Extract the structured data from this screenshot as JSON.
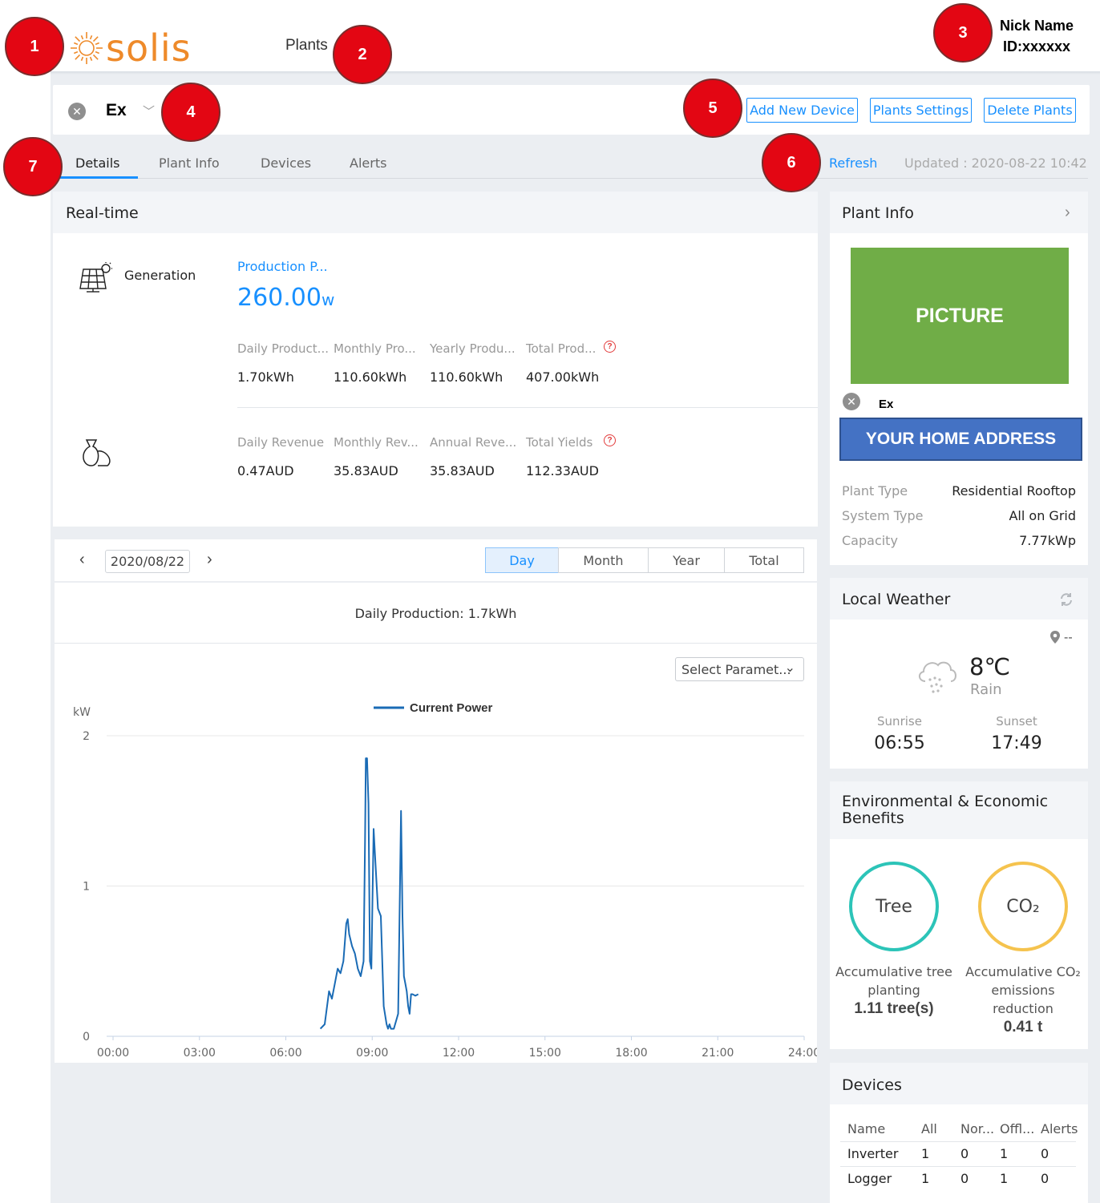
{
  "header": {
    "logo_text": "solis",
    "nav_plants": "Plants",
    "user_nick": "Nick Name",
    "user_id": "ID:xxxxxx"
  },
  "callouts": [
    "1",
    "2",
    "3",
    "4",
    "5",
    "6",
    "7"
  ],
  "plant_bar": {
    "plant_name": "Ex",
    "buttons": {
      "add_device": "Add New Device",
      "plant_settings": "Plants Settings",
      "delete_plants": "Delete Plants"
    }
  },
  "tabs": {
    "details": "Details",
    "plant_info": "Plant Info",
    "devices": "Devices",
    "alerts": "Alerts",
    "active": "Details"
  },
  "refresh": {
    "label": "Refresh",
    "updated": "Updated : 2020-08-22 10:42"
  },
  "realtime": {
    "title": "Real-time",
    "generation_label": "Generation",
    "production_label": "Production P...",
    "production_value": "260.00",
    "production_unit": "w",
    "production_stats": [
      {
        "label": "Daily Product...",
        "value": "1.70kWh"
      },
      {
        "label": "Monthly Pro...",
        "value": "110.60kWh"
      },
      {
        "label": "Yearly Produ...",
        "value": "110.60kWh"
      },
      {
        "label": "Total Prod...",
        "value": "407.00kWh"
      }
    ],
    "revenue_stats": [
      {
        "label": "Daily Revenue",
        "value": "0.47AUD"
      },
      {
        "label": "Monthly Rev...",
        "value": "35.83AUD"
      },
      {
        "label": "Annual Reve...",
        "value": "35.83AUD"
      },
      {
        "label": "Total Yields",
        "value": "112.33AUD"
      }
    ],
    "help_glyph": "?"
  },
  "chart_controls": {
    "prev": "‹",
    "next": "›",
    "date": "2020/08/22",
    "periods": [
      "Day",
      "Month",
      "Year",
      "Total"
    ],
    "active_period": "Day",
    "select_param": "Select Paramet...",
    "select_chevron": "⌄"
  },
  "chart_data": {
    "type": "line",
    "title": "Daily Production: 1.7kWh",
    "ylabel": "kW",
    "xlabel": "",
    "ylim": [
      0,
      2
    ],
    "yticks": [
      "0",
      "1",
      "2"
    ],
    "xticks": [
      "00:00",
      "03:00",
      "06:00",
      "09:00",
      "12:00",
      "15:00",
      "18:00",
      "21:00",
      "24:00"
    ],
    "xlim_hours": [
      0,
      24
    ],
    "grid": true,
    "legend_position": "top",
    "color": "#1a6bb5",
    "series": [
      {
        "name": "Current Power",
        "x": [
          7.2,
          7.35,
          7.5,
          7.6,
          7.7,
          7.8,
          7.9,
          8.0,
          8.1,
          8.15,
          8.2,
          8.3,
          8.4,
          8.5,
          8.6,
          8.7,
          8.75,
          8.78,
          8.82,
          8.87,
          8.92,
          8.97,
          9.05,
          9.1,
          9.2,
          9.3,
          9.4,
          9.5,
          9.55,
          9.6,
          9.65,
          9.75,
          9.9,
          10.0,
          10.05,
          10.1,
          10.15,
          10.2,
          10.25,
          10.3,
          10.35,
          10.4,
          10.5,
          10.6
        ],
        "y": [
          0.05,
          0.08,
          0.3,
          0.25,
          0.35,
          0.45,
          0.42,
          0.5,
          0.75,
          0.78,
          0.68,
          0.6,
          0.55,
          0.45,
          0.4,
          0.5,
          1.3,
          1.85,
          1.85,
          1.55,
          0.5,
          0.45,
          1.38,
          1.2,
          0.85,
          0.8,
          0.2,
          0.08,
          0.05,
          0.08,
          0.05,
          0.05,
          0.15,
          1.5,
          0.8,
          0.4,
          0.35,
          0.3,
          0.2,
          0.15,
          0.28,
          0.28,
          0.27,
          0.28
        ]
      }
    ]
  },
  "plant_info": {
    "title": "Plant Info",
    "picture_label": "PICTURE",
    "plant_name": "Ex",
    "address": "YOUR HOME ADDRESS",
    "rows": [
      {
        "label": "Plant Type",
        "value": "Residential Rooftop"
      },
      {
        "label": "System Type",
        "value": "All on Grid"
      },
      {
        "label": "Capacity",
        "value": "7.77kWp"
      }
    ],
    "chevron": "›"
  },
  "weather": {
    "title": "Local Weather",
    "location": "--",
    "temperature": "8℃",
    "condition": "Rain",
    "sunrise_label": "Sunrise",
    "sunrise": "06:55",
    "sunset_label": "Sunset",
    "sunset": "17:49",
    "icon": "rain-cloud-icon"
  },
  "benefits": {
    "title_line1": "Environmental & Economic",
    "title_line2": "Benefits",
    "tree_circle": "Tree",
    "tree_desc_line1": "Accumulative tree",
    "tree_desc_line2": "planting",
    "tree_value": "1.11 tree(s)",
    "co2_circle": "CO₂",
    "co2_desc_line1": "Accumulative CO₂",
    "co2_desc_line2": "emissions",
    "co2_desc_line3": "reduction",
    "co2_value": "0.41 t",
    "tree_color": "#2cc4b8",
    "co2_color": "#f5c34e"
  },
  "devices": {
    "title": "Devices",
    "headers": [
      "Name",
      "All",
      "Nor...",
      "Offl...",
      "Alerts"
    ],
    "rows": [
      [
        "Inverter",
        "1",
        "0",
        "1",
        "0"
      ],
      [
        "Logger",
        "1",
        "0",
        "1",
        "0"
      ]
    ]
  },
  "colors": {
    "accent": "#1890ff",
    "brand": "#ee8a2a",
    "callout": "#e30613",
    "picture": "#70ad47",
    "address": "#4472c4"
  }
}
